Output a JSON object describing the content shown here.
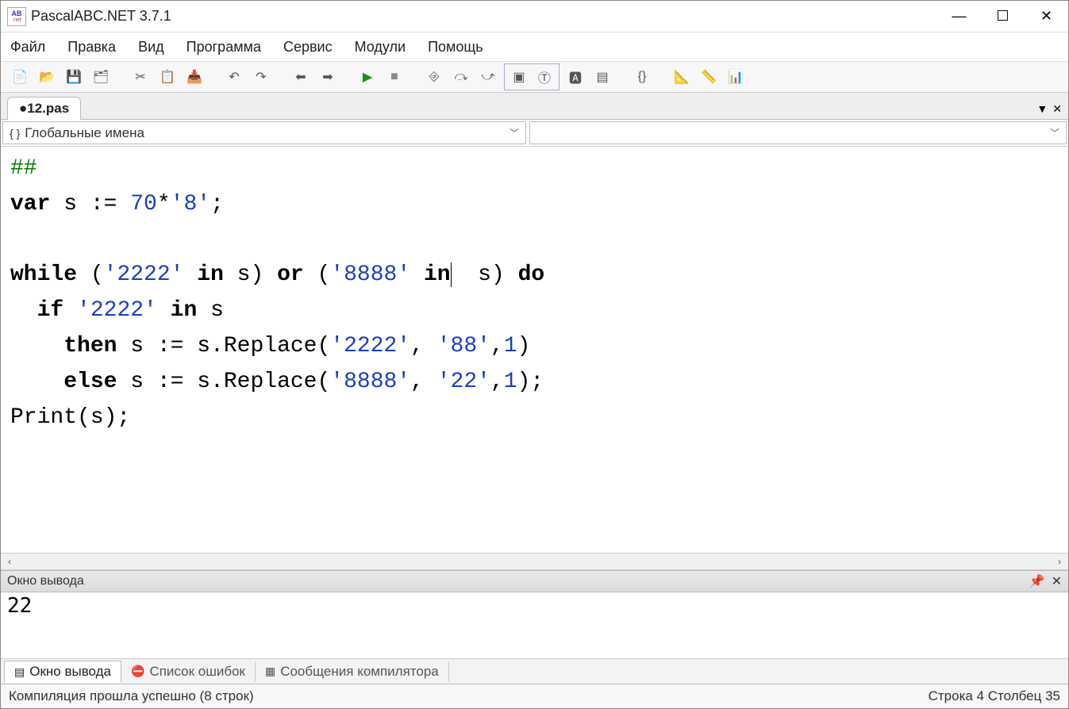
{
  "window": {
    "title": "PascalABC.NET 3.7.1",
    "app_icon_top": "AB",
    "app_icon_bottom": ".net"
  },
  "menu": {
    "items": [
      "Файл",
      "Правка",
      "Вид",
      "Программа",
      "Сервис",
      "Модули",
      "Помощь"
    ]
  },
  "toolbar": {
    "buttons": [
      {
        "name": "new-file-icon",
        "glyph": "📄"
      },
      {
        "name": "open-icon",
        "glyph": "📂"
      },
      {
        "name": "save-icon",
        "glyph": "💾"
      },
      {
        "name": "save-all-icon",
        "glyph": "🗂"
      },
      {
        "sep": true
      },
      {
        "name": "cut-icon",
        "glyph": "✂"
      },
      {
        "name": "copy-icon",
        "glyph": "📋"
      },
      {
        "name": "paste-icon",
        "glyph": "📥"
      },
      {
        "sep": true
      },
      {
        "name": "undo-icon",
        "glyph": "↶"
      },
      {
        "name": "redo-icon",
        "glyph": "↷"
      },
      {
        "sep": true
      },
      {
        "name": "nav-back-icon",
        "glyph": "⬅"
      },
      {
        "name": "nav-fwd-icon",
        "glyph": "➡"
      },
      {
        "sep": true
      },
      {
        "name": "run-icon",
        "glyph": "▶",
        "color": "#1a8f1a"
      },
      {
        "name": "stop-icon",
        "glyph": "■",
        "color": "#888"
      },
      {
        "sep": true
      },
      {
        "name": "step-into-icon",
        "glyph": "⎆"
      },
      {
        "name": "step-over-icon",
        "glyph": "⤼"
      },
      {
        "name": "step-out-icon",
        "glyph": "⤻"
      },
      {
        "group": true,
        "items": [
          {
            "name": "console-icon",
            "glyph": "▣"
          },
          {
            "name": "text-icon",
            "glyph": "Ⓣ"
          }
        ]
      },
      {
        "name": "abc-icon",
        "glyph": "🅰"
      },
      {
        "name": "list-icon",
        "glyph": "▤"
      },
      {
        "sep": true
      },
      {
        "name": "code-icon",
        "glyph": "{}"
      },
      {
        "sep": true
      },
      {
        "name": "designer-d-icon",
        "glyph": "📐"
      },
      {
        "name": "designer-l-icon",
        "glyph": "📏"
      },
      {
        "name": "designer-r-icon",
        "glyph": "📊"
      }
    ]
  },
  "tabs": {
    "file_label": "●12.pas"
  },
  "scope": {
    "label": "Глобальные имена"
  },
  "code": {
    "tokens": [
      [
        {
          "t": "##",
          "c": "green"
        }
      ],
      [
        {
          "t": "var",
          "c": "kwb"
        },
        {
          "t": " s := "
        },
        {
          "t": "70",
          "c": "num"
        },
        {
          "t": "*"
        },
        {
          "t": "'8'",
          "c": "str"
        },
        {
          "t": ";"
        }
      ],
      [],
      [
        {
          "t": "while",
          "c": "kwb"
        },
        {
          "t": " ("
        },
        {
          "t": "'2222'",
          "c": "str"
        },
        {
          "t": " "
        },
        {
          "t": "in",
          "c": "kwb"
        },
        {
          "t": " s) "
        },
        {
          "t": "or",
          "c": "kwb"
        },
        {
          "t": " ("
        },
        {
          "t": "'8888'",
          "c": "str"
        },
        {
          "t": " "
        },
        {
          "t": "in",
          "c": "kwb"
        },
        {
          "t": " ",
          "cursor": true
        },
        {
          "t": " s) "
        },
        {
          "t": "do",
          "c": "kwb"
        }
      ],
      [
        {
          "t": "  "
        },
        {
          "t": "if",
          "c": "kwb"
        },
        {
          "t": " "
        },
        {
          "t": "'2222'",
          "c": "str"
        },
        {
          "t": " "
        },
        {
          "t": "in",
          "c": "kwb"
        },
        {
          "t": " s"
        }
      ],
      [
        {
          "t": "    "
        },
        {
          "t": "then",
          "c": "kwb"
        },
        {
          "t": " s := s.Replace("
        },
        {
          "t": "'2222'",
          "c": "str"
        },
        {
          "t": ", "
        },
        {
          "t": "'88'",
          "c": "str"
        },
        {
          "t": ","
        },
        {
          "t": "1",
          "c": "num"
        },
        {
          "t": ")"
        }
      ],
      [
        {
          "t": "    "
        },
        {
          "t": "else",
          "c": "kwb"
        },
        {
          "t": " s := s.Replace("
        },
        {
          "t": "'8888'",
          "c": "str"
        },
        {
          "t": ", "
        },
        {
          "t": "'22'",
          "c": "str"
        },
        {
          "t": ","
        },
        {
          "t": "1",
          "c": "num"
        },
        {
          "t": ");"
        }
      ],
      [
        {
          "t": "Print(s);"
        }
      ]
    ]
  },
  "output": {
    "header": "Окно вывода",
    "text": "22"
  },
  "bottom_tabs": [
    {
      "id": "out",
      "label": "Окно вывода",
      "icon": "▤",
      "active": true
    },
    {
      "id": "err",
      "label": "Список ошибок",
      "icon": "⛔",
      "active": false
    },
    {
      "id": "msg",
      "label": "Сообщения компилятора",
      "icon": "▦",
      "active": false
    }
  ],
  "status": {
    "left": "Компиляция прошла успешно (8 строк)",
    "right": "Строка 4 Столбец 35"
  }
}
